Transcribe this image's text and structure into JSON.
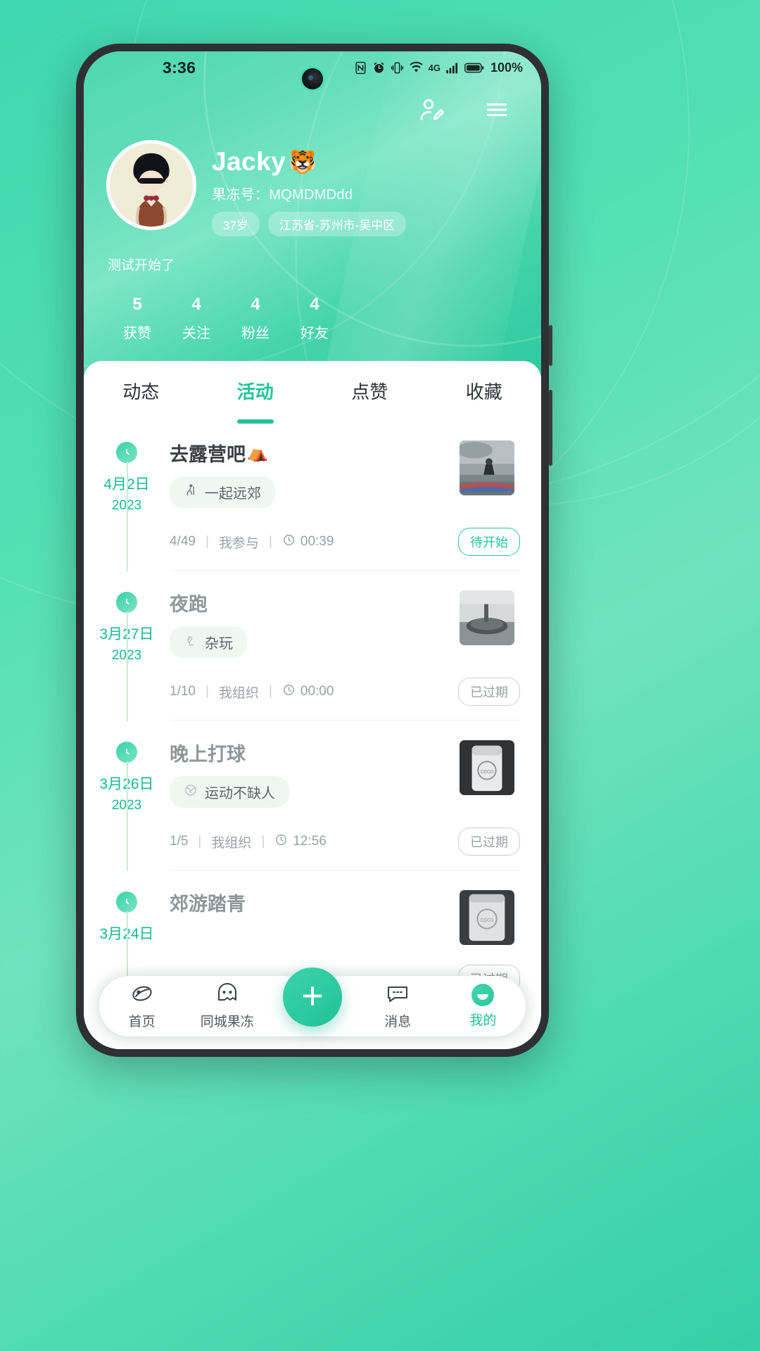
{
  "statusbar": {
    "time": "3:36",
    "battery": "100%",
    "network": "4G",
    "icons": [
      "nfc-icon",
      "alarm-icon",
      "vibrate-icon",
      "wifi-icon",
      "signal-icon",
      "battery-icon"
    ]
  },
  "header": {
    "edit_profile_icon": "user-edit-icon",
    "menu_icon": "hamburger-menu-icon",
    "name": "Jacky",
    "name_emoji": "🐯",
    "jelly_id_label": "果冻号：",
    "jelly_id_value": "MQMDMDdd",
    "chips": [
      "37岁",
      "江苏省-苏州市-吴中区"
    ],
    "bio": "测试开始了",
    "stats": [
      {
        "num": "5",
        "label": "获赞"
      },
      {
        "num": "4",
        "label": "关注"
      },
      {
        "num": "4",
        "label": "粉丝"
      },
      {
        "num": "4",
        "label": "好友"
      }
    ]
  },
  "tabs": [
    {
      "label": "动态",
      "active": false
    },
    {
      "label": "活动",
      "active": true
    },
    {
      "label": "点赞",
      "active": false
    },
    {
      "label": "收藏",
      "active": false
    }
  ],
  "activities": [
    {
      "date": "4月2日",
      "year": "2023",
      "title": "去露营吧",
      "title_emoji": "⛺",
      "tag_icon": "hiking-icon",
      "tag": "一起远郊",
      "count": "4/49",
      "role": "我参与",
      "time": "00:39",
      "status": "待开始",
      "status_type": "upcoming",
      "dimmed": false
    },
    {
      "date": "3月27日",
      "year": "2023",
      "title": "夜跑",
      "title_emoji": "",
      "tag_icon": "chess-knight-icon",
      "tag": "杂玩",
      "count": "1/10",
      "role": "我组织",
      "time": "00:00",
      "status": "已过期",
      "status_type": "expired",
      "dimmed": true
    },
    {
      "date": "3月26日",
      "year": "2023",
      "title": "晚上打球",
      "title_emoji": "",
      "tag_icon": "ball-icon",
      "tag": "运动不缺人",
      "count": "1/5",
      "role": "我组织",
      "time": "12:56",
      "status": "已过期",
      "status_type": "expired",
      "dimmed": true
    },
    {
      "date": "3月24日",
      "year": "",
      "title": "郊游踏青",
      "title_emoji": "",
      "tag_icon": "",
      "tag": "",
      "count": "",
      "role": "",
      "time": "",
      "status": "已过期",
      "status_type": "expired",
      "dimmed": true
    }
  ],
  "bottom_nav": [
    {
      "label": "首页",
      "icon": "home-jelly-icon",
      "active": false
    },
    {
      "label": "同城果冻",
      "icon": "ghost-icon",
      "active": false
    },
    {
      "label": "消息",
      "icon": "chat-icon",
      "active": false
    },
    {
      "label": "我的",
      "icon": "profile-avatar-icon",
      "active": true
    }
  ],
  "fab": {
    "label": "+",
    "name": "create-button"
  },
  "colors": {
    "accent": "#22c49a",
    "accent_dark": "#12bb92",
    "header_gradient_start": "#4ed8b0",
    "header_gradient_end": "#2fc9a0",
    "expired_gray": "#9aa0a3"
  }
}
